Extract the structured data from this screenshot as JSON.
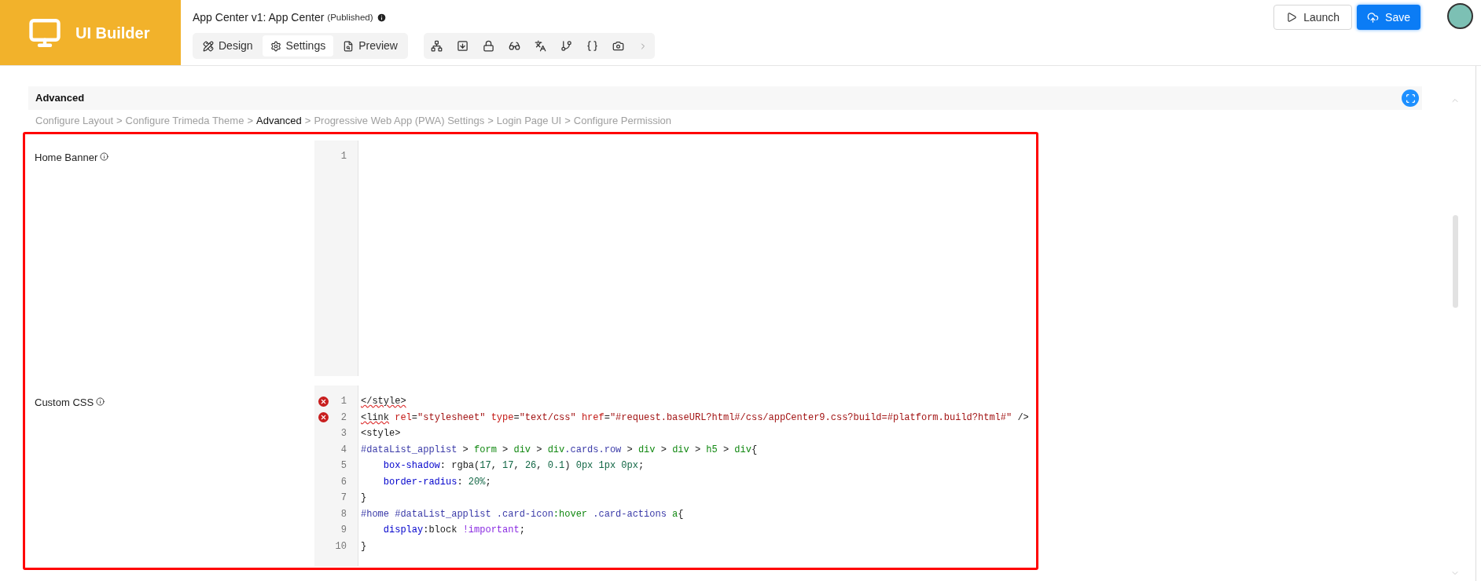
{
  "app": {
    "name": "UI Builder"
  },
  "header": {
    "title": "App Center v1: App Center",
    "status": "(Published)"
  },
  "tabs": [
    {
      "label": "Design",
      "kind": "design",
      "selected": false
    },
    {
      "label": "Settings",
      "kind": "settings",
      "selected": true
    },
    {
      "label": "Preview",
      "kind": "preview",
      "selected": false
    }
  ],
  "toolbar": [
    {
      "kind": "tree"
    },
    {
      "kind": "list"
    },
    {
      "kind": "lock"
    },
    {
      "kind": "glasses"
    },
    {
      "kind": "translate"
    },
    {
      "kind": "branch"
    },
    {
      "kind": "braces"
    },
    {
      "kind": "camera"
    },
    {
      "kind": "more"
    }
  ],
  "actions": [
    {
      "label": "Launch",
      "kind": "launch"
    },
    {
      "label": "Save",
      "kind": "save"
    }
  ],
  "section": {
    "title": "Advanced"
  },
  "breadcrumb": [
    {
      "label": "Configure Layout",
      "selected": false
    },
    {
      "label": "Configure Trimeda Theme",
      "selected": false
    },
    {
      "label": "Advanced",
      "selected": true
    },
    {
      "label": "Progressive Web App (PWA) Settings",
      "selected": false
    },
    {
      "label": "Login Page UI",
      "selected": false
    },
    {
      "label": "Configure Permission",
      "selected": false
    }
  ],
  "breadcrumb_separator": ">",
  "fields": [
    {
      "label": "Home Banner",
      "lines": [
        {
          "number": "1",
          "error": false
        }
      ]
    },
    {
      "label": "Custom CSS",
      "lines": [
        {
          "number": "1",
          "error": true,
          "tokens": [
            {
              "t": "</style>",
              "kind": "bad"
            }
          ]
        },
        {
          "number": "2",
          "error": true,
          "tokens": [
            {
              "t": "<link",
              "kind": "bad"
            },
            {
              "t": " rel",
              "kind": "attr"
            },
            {
              "t": "=",
              "kind": "plain"
            },
            {
              "t": "\"stylesheet\"",
              "kind": "str"
            },
            {
              "t": " type",
              "kind": "attr"
            },
            {
              "t": "=",
              "kind": "plain"
            },
            {
              "t": "\"text/css\"",
              "kind": "str"
            },
            {
              "t": " href",
              "kind": "attr"
            },
            {
              "t": "=",
              "kind": "plain"
            },
            {
              "t": "\"#request.baseURL?html#/css/appCenter9.css?build=#platform.build?html#\"",
              "kind": "str"
            },
            {
              "t": " />",
              "kind": "plain"
            }
          ]
        },
        {
          "number": "3",
          "error": false,
          "tokens": [
            {
              "t": "<style>",
              "kind": "plain"
            }
          ]
        },
        {
          "number": "4",
          "error": false,
          "tokens": [
            {
              "t": "#dataList_applist",
              "kind": "sel"
            },
            {
              "t": " > ",
              "kind": "plain"
            },
            {
              "t": "form",
              "kind": "tag"
            },
            {
              "t": " > ",
              "kind": "plain"
            },
            {
              "t": "div",
              "kind": "tag"
            },
            {
              "t": " > ",
              "kind": "plain"
            },
            {
              "t": "div",
              "kind": "tag"
            },
            {
              "t": ".cards.row",
              "kind": "sel"
            },
            {
              "t": " > ",
              "kind": "plain"
            },
            {
              "t": "div",
              "kind": "tag"
            },
            {
              "t": " > ",
              "kind": "plain"
            },
            {
              "t": "div",
              "kind": "tag"
            },
            {
              "t": " > ",
              "kind": "plain"
            },
            {
              "t": "h5",
              "kind": "tag"
            },
            {
              "t": " > ",
              "kind": "plain"
            },
            {
              "t": "div",
              "kind": "tag"
            },
            {
              "t": "{",
              "kind": "plain"
            }
          ]
        },
        {
          "number": "5",
          "error": false,
          "tokens": [
            {
              "t": "    box-shadow",
              "kind": "prop"
            },
            {
              "t": ": rgba(",
              "kind": "plain"
            },
            {
              "t": "17",
              "kind": "num"
            },
            {
              "t": ", ",
              "kind": "plain"
            },
            {
              "t": "17",
              "kind": "num"
            },
            {
              "t": ", ",
              "kind": "plain"
            },
            {
              "t": "26",
              "kind": "num"
            },
            {
              "t": ", ",
              "kind": "plain"
            },
            {
              "t": "0.1",
              "kind": "num"
            },
            {
              "t": ") ",
              "kind": "plain"
            },
            {
              "t": "0px 1px 0px",
              "kind": "num"
            },
            {
              "t": ";",
              "kind": "plain"
            }
          ]
        },
        {
          "number": "6",
          "error": false,
          "tokens": [
            {
              "t": "    border-radius",
              "kind": "prop"
            },
            {
              "t": ": ",
              "kind": "plain"
            },
            {
              "t": "20%",
              "kind": "num"
            },
            {
              "t": ";",
              "kind": "plain"
            }
          ]
        },
        {
          "number": "7",
          "error": false,
          "tokens": [
            {
              "t": "}",
              "kind": "plain"
            }
          ]
        },
        {
          "number": "8",
          "error": false,
          "tokens": [
            {
              "t": "#home #dataList_applist .card-icon",
              "kind": "sel"
            },
            {
              "t": ":hover",
              "kind": "tag"
            },
            {
              "t": " .card-actions ",
              "kind": "sel"
            },
            {
              "t": "a",
              "kind": "tag"
            },
            {
              "t": "{",
              "kind": "plain"
            }
          ]
        },
        {
          "number": "9",
          "error": false,
          "tokens": [
            {
              "t": "    display",
              "kind": "prop"
            },
            {
              "t": ":block ",
              "kind": "plain"
            },
            {
              "t": "!important",
              "kind": "imp"
            },
            {
              "t": ";",
              "kind": "plain"
            }
          ]
        },
        {
          "number": "10",
          "error": false,
          "tokens": [
            {
              "t": "}",
              "kind": "plain"
            }
          ]
        }
      ]
    }
  ]
}
